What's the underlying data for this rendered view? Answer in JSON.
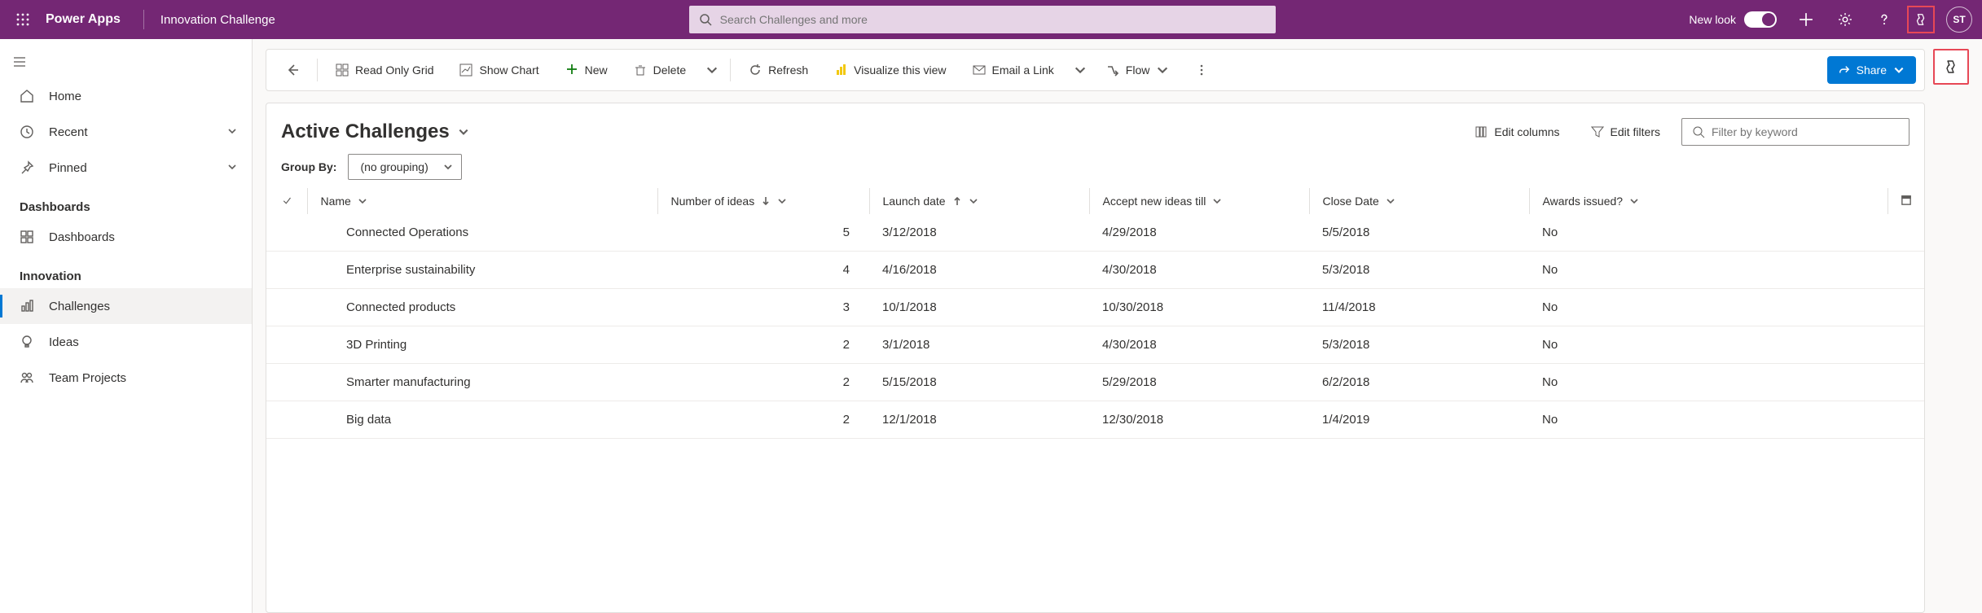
{
  "header": {
    "brand": "Power Apps",
    "app_name": "Innovation Challenge",
    "search_placeholder": "Search Challenges and more",
    "new_look_label": "New look",
    "avatar_initials": "ST"
  },
  "sidebar": {
    "items": {
      "home": "Home",
      "recent": "Recent",
      "pinned": "Pinned"
    },
    "sections": {
      "dashboards": "Dashboards",
      "innovation": "Innovation"
    },
    "dashboards_item": "Dashboards",
    "innovation_items": {
      "challenges": "Challenges",
      "ideas": "Ideas",
      "team_projects": "Team Projects"
    }
  },
  "commandbar": {
    "read_only_grid": "Read Only Grid",
    "show_chart": "Show Chart",
    "new": "New",
    "delete": "Delete",
    "refresh": "Refresh",
    "visualize": "Visualize this view",
    "email_link": "Email a Link",
    "flow": "Flow",
    "share": "Share"
  },
  "grid": {
    "view_title": "Active Challenges",
    "edit_columns": "Edit columns",
    "edit_filters": "Edit filters",
    "filter_placeholder": "Filter by keyword",
    "group_by_label": "Group By:",
    "group_by_value": "(no grouping)",
    "columns": {
      "name": "Name",
      "ideas": "Number of ideas",
      "launch": "Launch date",
      "accept": "Accept new ideas till",
      "close": "Close Date",
      "awards": "Awards issued?"
    },
    "rows": [
      {
        "name": "Connected Operations",
        "ideas": "5",
        "launch": "3/12/2018",
        "accept": "4/29/2018",
        "close": "5/5/2018",
        "awards": "No"
      },
      {
        "name": "Enterprise sustainability",
        "ideas": "4",
        "launch": "4/16/2018",
        "accept": "4/30/2018",
        "close": "5/3/2018",
        "awards": "No"
      },
      {
        "name": "Connected products",
        "ideas": "3",
        "launch": "10/1/2018",
        "accept": "10/30/2018",
        "close": "11/4/2018",
        "awards": "No"
      },
      {
        "name": "3D Printing",
        "ideas": "2",
        "launch": "3/1/2018",
        "accept": "4/30/2018",
        "close": "5/3/2018",
        "awards": "No"
      },
      {
        "name": "Smarter manufacturing",
        "ideas": "2",
        "launch": "5/15/2018",
        "accept": "5/29/2018",
        "close": "6/2/2018",
        "awards": "No"
      },
      {
        "name": "Big data",
        "ideas": "2",
        "launch": "12/1/2018",
        "accept": "12/30/2018",
        "close": "1/4/2019",
        "awards": "No"
      }
    ]
  }
}
